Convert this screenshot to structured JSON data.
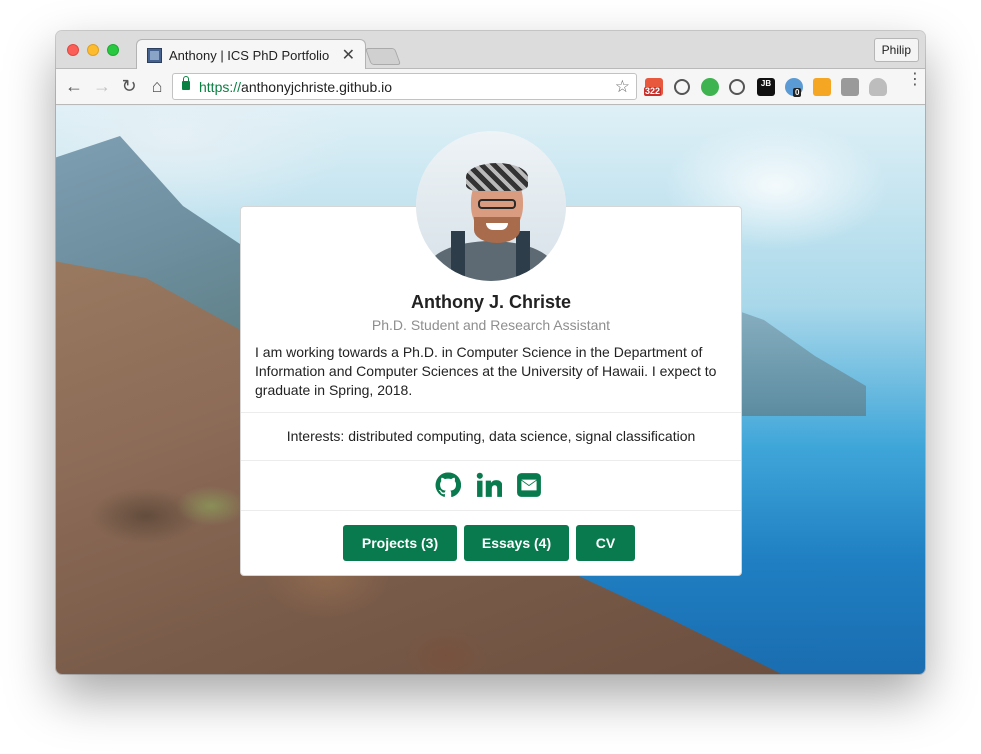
{
  "browser": {
    "tab": {
      "title": "Anthony | ICS PhD Portfolio",
      "close": "✕"
    },
    "profile": "Philip",
    "toolbar": {
      "back": "←",
      "forward": "→",
      "reload": "↻",
      "home": "⌂",
      "star": "☆",
      "menu": "⋮"
    },
    "url": {
      "scheme": "https://",
      "host": "anthonyjchriste.github.io"
    },
    "extensions": [
      {
        "icon": "counter-extension-icon",
        "badge": "322"
      },
      {
        "icon": "sync-extension-icon"
      },
      {
        "icon": "evernote-extension-icon"
      },
      {
        "icon": "1password-extension-icon"
      },
      {
        "icon": "jetbrains-extension-icon",
        "glyph": "JB"
      },
      {
        "icon": "privacy-extension-icon",
        "badge": "0"
      },
      {
        "icon": "analytics-extension-icon"
      },
      {
        "icon": "editor-extension-icon"
      },
      {
        "icon": "cloud-extension-icon"
      }
    ]
  },
  "profile_card": {
    "name": "Anthony J. Christe",
    "subtitle": "Ph.D. Student and Research Assistant",
    "bio": "I am working towards a Ph.D. in Computer Science in the Department of Information and Computer Sciences at the University of Hawaii. I expect to graduate in Spring, 2018.",
    "interests": "Interests: distributed computing, data science, signal classification",
    "social": [
      "github-icon",
      "linkedin-icon",
      "email-icon"
    ],
    "buttons": {
      "projects": "Projects (3)",
      "essays": "Essays (4)",
      "cv": "CV"
    }
  },
  "colors": {
    "accent": "#087a4d",
    "secure_url": "#0b8043"
  }
}
